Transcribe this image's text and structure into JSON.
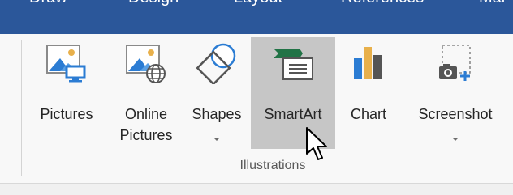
{
  "tabs": [
    "Draw",
    "Design",
    "Layout",
    "References",
    "Mai"
  ],
  "group": {
    "label": "Illustrations"
  },
  "buttons": {
    "pictures": {
      "label": "Pictures",
      "icon": "picture-monitor-icon"
    },
    "online_pictures": {
      "label_line1": "Online",
      "label_line2": "Pictures",
      "icon": "online-picture-globe-icon"
    },
    "shapes": {
      "label": "Shapes",
      "icon": "shapes-icon"
    },
    "smartart": {
      "label": "SmartArt",
      "icon": "smartart-icon",
      "state": "hovered"
    },
    "chart": {
      "label": "Chart",
      "icon": "bar-chart-icon"
    },
    "screenshot": {
      "label": "Screenshot",
      "icon": "camera-plus-icon"
    }
  },
  "colors": {
    "tab_bar": "#2b579a",
    "hover": "#c6c6c6",
    "icon_blue": "#2b7cd3",
    "icon_green": "#217346",
    "icon_orange": "#e8b04b"
  }
}
